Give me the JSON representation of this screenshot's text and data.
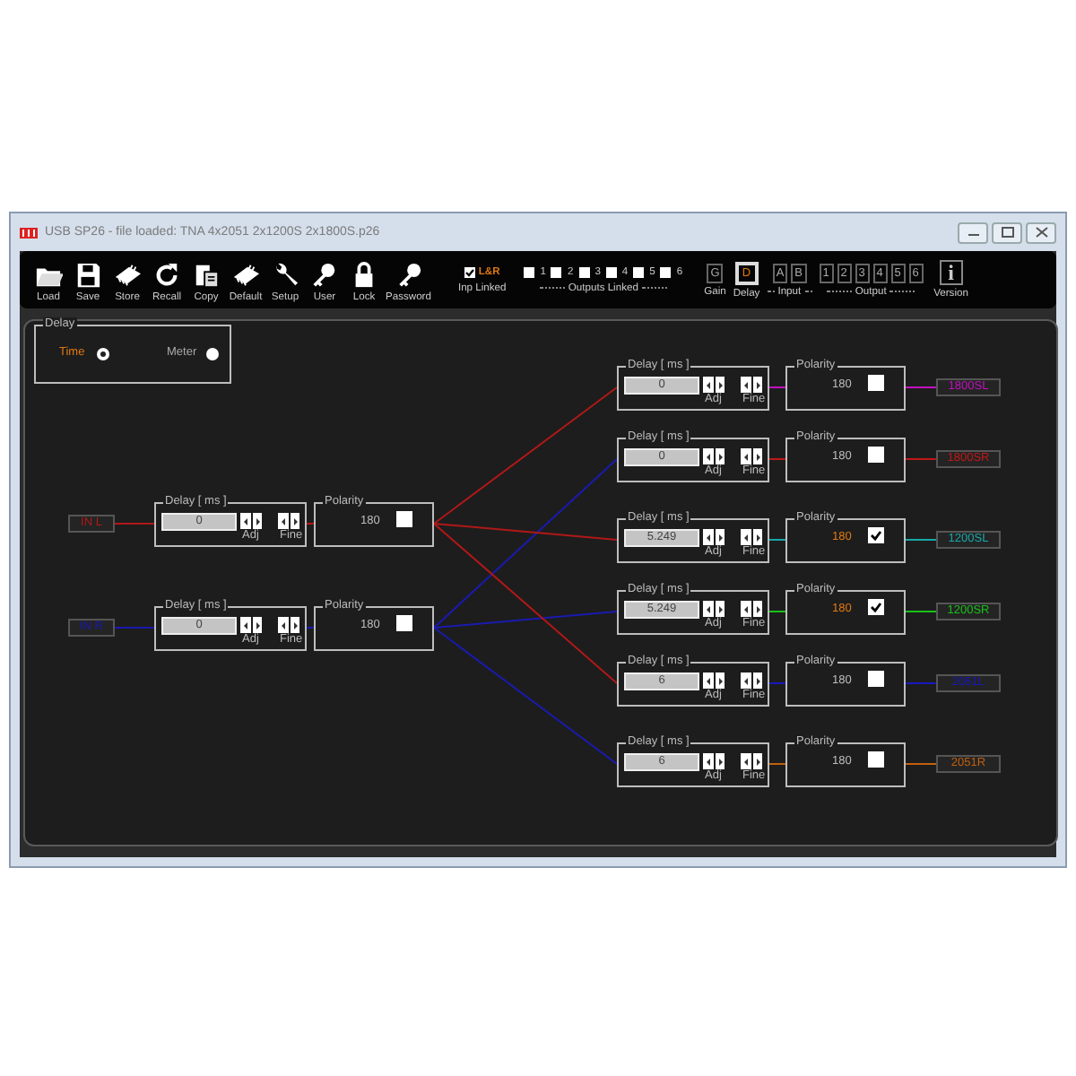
{
  "window": {
    "title": "USB  SP26  - file loaded: TNA 4x2051 2x1200S 2x1800S.p26"
  },
  "toolbar": {
    "buttons": [
      {
        "label": "Load"
      },
      {
        "label": "Save"
      },
      {
        "label": "Store"
      },
      {
        "label": "Recall"
      },
      {
        "label": "Copy"
      },
      {
        "label": "Default"
      },
      {
        "label": "Setup"
      },
      {
        "label": "User"
      },
      {
        "label": "Lock"
      },
      {
        "label": "Password"
      }
    ],
    "input_link": {
      "label": "L&R",
      "checked": true,
      "caption": "Inp Linked"
    },
    "outputs_linked": {
      "caption": "Outputs Linked",
      "items": [
        {
          "label": "1",
          "checked": false
        },
        {
          "label": "2",
          "checked": false
        },
        {
          "label": "3",
          "checked": false
        },
        {
          "label": "4",
          "checked": false
        },
        {
          "label": "5",
          "checked": false
        },
        {
          "label": "6",
          "checked": false
        }
      ]
    },
    "view_groups": [
      {
        "caption": "Gain",
        "buttons": [
          {
            "label": "G",
            "selected": false
          }
        ]
      },
      {
        "caption": "Delay",
        "buttons": [
          {
            "label": "D",
            "selected": true
          }
        ]
      },
      {
        "caption": "Input",
        "buttons": [
          {
            "label": "A",
            "selected": false
          },
          {
            "label": "B",
            "selected": false
          }
        ]
      },
      {
        "caption": "Output",
        "buttons": [
          {
            "label": "1",
            "selected": false
          },
          {
            "label": "2",
            "selected": false
          },
          {
            "label": "3",
            "selected": false
          },
          {
            "label": "4",
            "selected": false
          },
          {
            "label": "5",
            "selected": false
          },
          {
            "label": "6",
            "selected": false
          }
        ]
      },
      {
        "caption": "Version",
        "buttons": [
          {
            "label": "i",
            "selected": false
          }
        ]
      }
    ]
  },
  "delay_mode": {
    "title": "Delay",
    "options": [
      {
        "label": "Time",
        "selected": true
      },
      {
        "label": "Meter",
        "selected": false
      }
    ]
  },
  "inputs": [
    {
      "label": "IN L",
      "color": "#b01818",
      "delay": {
        "title": "Delay [ ms ]",
        "value": "0",
        "adj": "Adj",
        "fine": "Fine"
      },
      "polarity": {
        "title": "Polarity",
        "value": "180",
        "checked": false
      }
    },
    {
      "label": "IN R",
      "color": "#1a1ab0",
      "delay": {
        "title": "Delay [ ms ]",
        "value": "0",
        "adj": "Adj",
        "fine": "Fine"
      },
      "polarity": {
        "title": "Polarity",
        "value": "180",
        "checked": false
      }
    }
  ],
  "outputs": [
    {
      "label": "1800SL",
      "color": "#c010c0",
      "from_left_input": true,
      "delay": {
        "title": "Delay [ ms ]",
        "value": "0",
        "adj": "Adj",
        "fine": "Fine"
      },
      "polarity": {
        "title": "Polarity",
        "value": "180",
        "checked": false
      }
    },
    {
      "label": "1800SR",
      "color": "#c01818",
      "from_left_input": false,
      "delay": {
        "title": "Delay [ ms ]",
        "value": "0",
        "adj": "Adj",
        "fine": "Fine"
      },
      "polarity": {
        "title": "Polarity",
        "value": "180",
        "checked": false
      }
    },
    {
      "label": "1200SL",
      "color": "#18a8a8",
      "from_left_input": true,
      "delay": {
        "title": "Delay [ ms ]",
        "value": "5.249",
        "adj": "Adj",
        "fine": "Fine"
      },
      "polarity": {
        "title": "Polarity",
        "value": "180",
        "checked": true
      }
    },
    {
      "label": "1200SR",
      "color": "#18c018",
      "from_left_input": false,
      "delay": {
        "title": "Delay [ ms ]",
        "value": "5.249",
        "adj": "Adj",
        "fine": "Fine"
      },
      "polarity": {
        "title": "Polarity",
        "value": "180",
        "checked": true
      }
    },
    {
      "label": "2051L",
      "color": "#1818c0",
      "from_left_input": true,
      "delay": {
        "title": "Delay [ ms ]",
        "value": "6",
        "adj": "Adj",
        "fine": "Fine"
      },
      "polarity": {
        "title": "Polarity",
        "value": "180",
        "checked": false
      }
    },
    {
      "label": "2051R",
      "color": "#c06010",
      "from_left_input": false,
      "delay": {
        "title": "Delay [ ms ]",
        "value": "6",
        "adj": "Adj",
        "fine": "Fine"
      },
      "polarity": {
        "title": "Polarity",
        "value": "180",
        "checked": false
      }
    }
  ]
}
